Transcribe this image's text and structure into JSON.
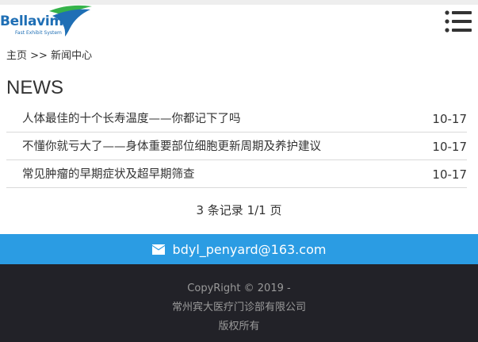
{
  "header": {
    "logo_text": "Bellavim",
    "logo_sub": "Fast Exhibit System",
    "menu_icon": "hamburger-icon",
    "brand_colors": {
      "blue": "#1f6fb5",
      "green": "#35b34a"
    }
  },
  "breadcrumb": {
    "home": "主页",
    "separator": ">>",
    "current": "新闻中心"
  },
  "news": {
    "heading": "NEWS",
    "items": [
      {
        "title": "人体最佳的十个长寿温度——你都记下了吗",
        "date": "10-17"
      },
      {
        "title": "不懂你就亏大了——身体重要部位细胞更新周期及养护建议",
        "date": "10-17"
      },
      {
        "title": "常见肿瘤的早期症状及超早期筛查",
        "date": "10-17"
      }
    ]
  },
  "pagination": {
    "text": "3 条记录 1/1 页"
  },
  "contact": {
    "icon": "envelope-icon",
    "email": "bdyl_penyard@163.com",
    "color": "#2b9ce3"
  },
  "footer": {
    "copyright": "CopyRight © 2019 -",
    "company": "常州宾大医疗门诊部有限公司",
    "rights": "版权所有",
    "background": "#222228"
  }
}
